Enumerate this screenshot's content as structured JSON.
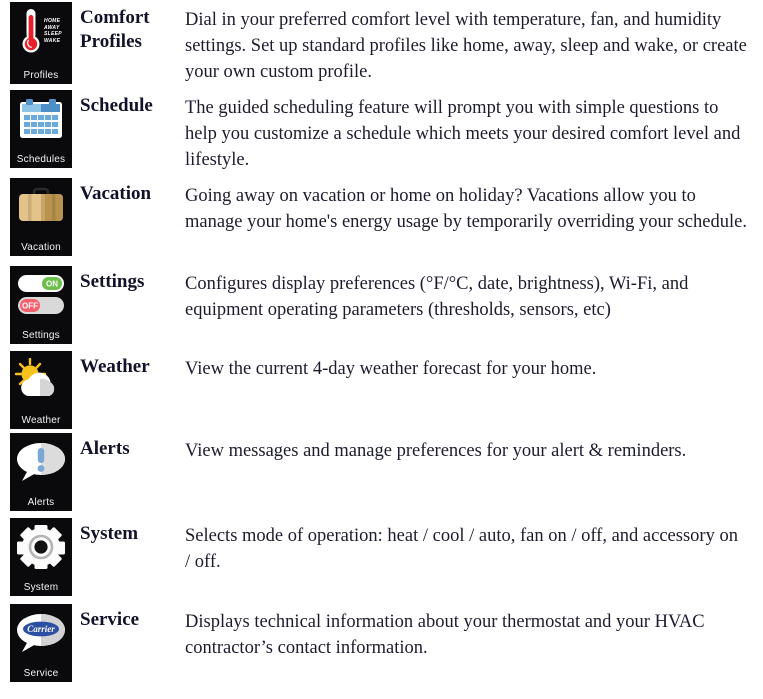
{
  "page": {
    "background_color": "#ffffff",
    "tile_background_color": "#0a0a0c",
    "heading_color": "#12122a",
    "body_text_color": "#1c1c2e"
  },
  "features": [
    {
      "icon_name": "thermometer-profiles-icon",
      "tile_caption": "Profiles",
      "heading": "Comfort Profiles",
      "description": "Dial in your preferred comfort level with temperature, fan, and humidity settings. Set up standard profiles like home, away, sleep and wake, or create your own custom profile.",
      "icon_labels": [
        "HOME",
        "AWAY",
        "SLEEP",
        "WAKE"
      ],
      "icon_colors": {
        "bulb": "#e8202a",
        "stem": "#ffffff"
      }
    },
    {
      "icon_name": "calendar-schedules-icon",
      "tile_caption": "Schedules",
      "heading": "Schedule",
      "description": "The guided scheduling feature will prompt you with simple questions to help you customize a schedule which meets your desired comfort level and lifestyle.",
      "icon_colors": {
        "header_light": "#8ec4e6",
        "header_dark": "#4f8fc7",
        "cell": "#6aa9dd"
      }
    },
    {
      "icon_name": "suitcase-vacation-icon",
      "tile_caption": "Vacation",
      "heading": "Vacation",
      "description": "Going away on vacation or home on holiday? Vacations allow you to manage your home's energy usage by temporarily overriding your schedule.",
      "icon_colors": {
        "light": "#e3c38a",
        "dark": "#b8934f",
        "handle": "#2a2a2a"
      }
    },
    {
      "icon_name": "toggle-switches-settings-icon",
      "tile_caption": "Settings",
      "heading": "Settings",
      "description": "Configures display preferences (°F/°C, date, brightness), Wi-Fi, and equipment operating parameters (thresholds, sensors, etc)",
      "toggle_on_label": "ON",
      "toggle_off_label": "OFF",
      "icon_colors": {
        "on": "#6cbf4b",
        "off": "#f4606d",
        "track_light": "#ffffff",
        "track_grey": "#d9d9d9"
      }
    },
    {
      "icon_name": "sun-cloud-weather-icon",
      "tile_caption": "Weather",
      "heading": "Weather",
      "description": "View the current 4-day weather forecast for your home.",
      "icon_colors": {
        "sun": "#f7c21b",
        "cloud_light": "#ffffff",
        "cloud_shade": "#d5d5d5"
      }
    },
    {
      "icon_name": "speech-bubble-alert-icon",
      "tile_caption": "Alerts",
      "heading": "Alerts",
      "description": "View messages and manage preferences for your alert & reminders.",
      "icon_colors": {
        "bubble": "#ffffff",
        "bubble_shade": "#dcdcdc",
        "mark": "#7ba7d4"
      }
    },
    {
      "icon_name": "gear-system-icon",
      "tile_caption": "System",
      "heading": "System",
      "description": "Selects mode of operation: heat / cool / auto, fan on / off, and accessory on / off.",
      "icon_colors": {
        "gear": "#fbfbfb",
        "ring": "#b4b4b4",
        "hub": "#111111"
      }
    },
    {
      "icon_name": "carrier-logo-service-icon",
      "tile_caption": "Service",
      "heading": "Service",
      "description": "Displays technical information about your thermostat and your HVAC contractor’s contact information.",
      "logo_text": "Carrier",
      "icon_colors": {
        "bubble": "#ffffff",
        "bubble_shade": "#d2d2d2",
        "logo": "#2b4fa2"
      }
    }
  ]
}
